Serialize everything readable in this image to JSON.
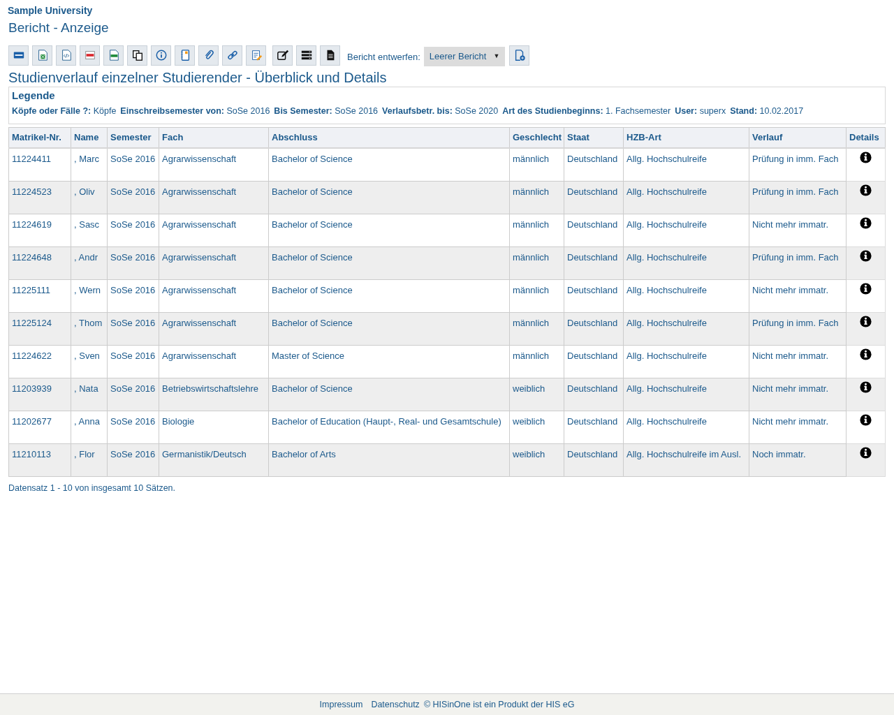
{
  "header": {
    "institution": "Sample University",
    "page_title": "Bericht - Anzeige"
  },
  "toolbar": {
    "buttons": [
      {
        "kind": "html"
      },
      {
        "kind": "excel"
      },
      {
        "kind": "xml"
      },
      {
        "kind": "pdf"
      },
      {
        "kind": "csv"
      },
      {
        "kind": "copy"
      },
      {
        "kind": "info"
      },
      {
        "kind": "notebook"
      },
      {
        "kind": "attach"
      },
      {
        "kind": "link"
      },
      {
        "kind": "notepad"
      },
      {
        "kind": "edit"
      },
      {
        "kind": "list"
      },
      {
        "kind": "document"
      }
    ],
    "draft_label": "Bericht entwerfen:",
    "draft_select": {
      "value": "Leerer Bericht",
      "caret": "▼"
    },
    "new_button": {
      "kind": "new-document"
    }
  },
  "report_title": "Studienverlauf einzelner Studierender - Überblick und Details",
  "legend": {
    "title": "Legende",
    "items": [
      {
        "label": "Köpfe oder Fälle ?:",
        "value": "Köpfe"
      },
      {
        "label": "Einschreibsemester von:",
        "value": "SoSe 2016"
      },
      {
        "label": "Bis Semester:",
        "value": "SoSe 2016"
      },
      {
        "label": "Verlaufsbetr. bis:",
        "value": "SoSe 2020"
      },
      {
        "label": "Art des Studienbeginns:",
        "value": "1. Fachsemester"
      },
      {
        "label": "User:",
        "value": "superx"
      },
      {
        "label": "Stand:",
        "value": "10.02.2017"
      }
    ]
  },
  "table": {
    "columns": [
      "Matrikel-Nr.",
      "Name",
      "Semester",
      "Fach",
      "Abschluss",
      "Geschlecht",
      "Staat",
      "HZB-Art",
      "Verlauf",
      "Details"
    ],
    "rows": [
      [
        "11224411",
        ", Marc",
        "SoSe 2016",
        "Agrarwissenschaft",
        "Bachelor of Science",
        "männlich",
        "Deutschland",
        "Allg. Hochschulreife",
        "Prüfung in imm. Fach"
      ],
      [
        "11224523",
        ", Oliv",
        "SoSe 2016",
        "Agrarwissenschaft",
        "Bachelor of Science",
        "männlich",
        "Deutschland",
        "Allg. Hochschulreife",
        "Prüfung in imm. Fach"
      ],
      [
        "11224619",
        ", Sasc",
        "SoSe 2016",
        "Agrarwissenschaft",
        "Bachelor of Science",
        "männlich",
        "Deutschland",
        "Allg. Hochschulreife",
        "Nicht mehr immatr."
      ],
      [
        "11224648",
        ", Andr",
        "SoSe 2016",
        "Agrarwissenschaft",
        "Bachelor of Science",
        "männlich",
        "Deutschland",
        "Allg. Hochschulreife",
        "Prüfung in imm. Fach"
      ],
      [
        "11225111",
        ", Wern",
        "SoSe 2016",
        "Agrarwissenschaft",
        "Bachelor of Science",
        "männlich",
        "Deutschland",
        "Allg. Hochschulreife",
        "Nicht mehr immatr."
      ],
      [
        "11225124",
        ", Thom",
        "SoSe 2016",
        "Agrarwissenschaft",
        "Bachelor of Science",
        "männlich",
        "Deutschland",
        "Allg. Hochschulreife",
        "Prüfung in imm. Fach"
      ],
      [
        "11224622",
        ", Sven",
        "SoSe 2016",
        "Agrarwissenschaft",
        "Master of Science",
        "männlich",
        "Deutschland",
        "Allg. Hochschulreife",
        "Nicht mehr immatr."
      ],
      [
        "11203939",
        ", Nata",
        "SoSe 2016",
        "Betriebswirtschaftslehre",
        "Bachelor of Science",
        "weiblich",
        "Deutschland",
        "Allg. Hochschulreife",
        "Nicht mehr immatr."
      ],
      [
        "11202677",
        ", Anna",
        "SoSe 2016",
        "Biologie",
        "Bachelor of Education (Haupt-, Real- und Gesamtschule)",
        "weiblich",
        "Deutschland",
        "Allg. Hochschulreife",
        "Nicht mehr immatr."
      ],
      [
        "11210113",
        ", Flor",
        "SoSe 2016",
        "Germanistik/Deutsch",
        "Bachelor of Arts",
        "weiblich",
        "Deutschland",
        "Allg. Hochschulreife im Ausl.",
        "Noch immatr."
      ]
    ]
  },
  "record_count": "Datensatz 1 - 10 von insgesamt 10 Sätzen.",
  "footer": {
    "links": [
      "Impressum",
      "Datenschutz"
    ],
    "copyright": "© HISinOne ist ein Produkt der HIS eG"
  }
}
